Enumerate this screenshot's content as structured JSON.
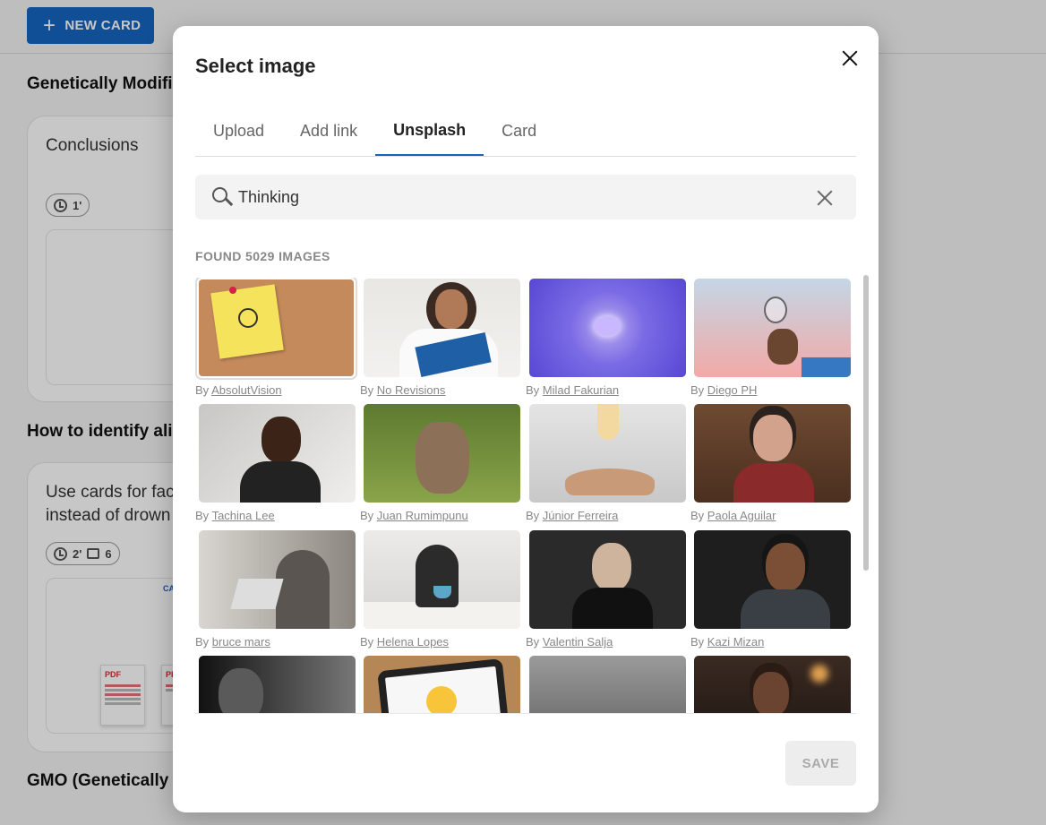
{
  "background": {
    "new_card_label": "NEW CARD",
    "sections": [
      {
        "heading": "Genetically Modifie",
        "card_title": "Conclusions",
        "pills": [
          {
            "icon": "clock-icon",
            "value": "1'"
          }
        ]
      },
      {
        "heading": "How to identify alie",
        "card_title_lines": [
          "Use cards for fac",
          "instead of drown"
        ],
        "pills": [
          {
            "icon": "clock-icon",
            "value": "2'"
          },
          {
            "icon": "image-icon",
            "value": "6"
          }
        ]
      },
      {
        "heading": "GMO (Genetically I"
      }
    ],
    "pdf_label": "PDF",
    "ca_label": "CA"
  },
  "dialog": {
    "title": "Select image",
    "tabs": [
      {
        "label": "Upload",
        "active": false
      },
      {
        "label": "Add link",
        "active": false
      },
      {
        "label": "Unsplash",
        "active": true
      },
      {
        "label": "Card",
        "active": false
      }
    ],
    "search": {
      "value": "Thinking"
    },
    "found_label": "FOUND 5029 IMAGES",
    "by_prefix": "By",
    "images": [
      {
        "author": "AbsolutVision",
        "selected": true
      },
      {
        "author": "No Revisions"
      },
      {
        "author": "Milad Fakurian"
      },
      {
        "author": "Diego PH"
      },
      {
        "author": "Tachina Lee"
      },
      {
        "author": "Juan Rumimpunu"
      },
      {
        "author": "Júnior Ferreira"
      },
      {
        "author": "Paola Aguilar"
      },
      {
        "author": "bruce mars"
      },
      {
        "author": "Helena Lopes"
      },
      {
        "author": "Valentin Salja"
      },
      {
        "author": "Kazi Mizan"
      },
      {
        "author": ""
      },
      {
        "author": ""
      },
      {
        "author": ""
      },
      {
        "author": ""
      }
    ],
    "save_label": "SAVE",
    "colors": {
      "accent": "#1565c0",
      "save_disabled_bg": "#ededed",
      "save_disabled_text": "#aaaaaa"
    }
  }
}
